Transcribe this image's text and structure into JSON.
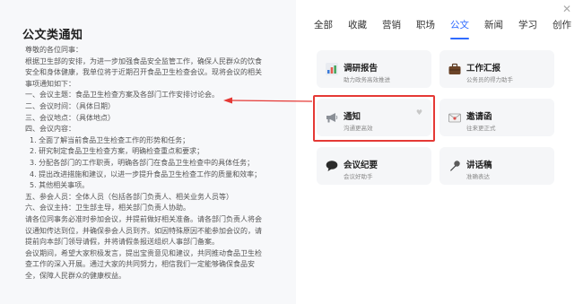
{
  "document": {
    "title": "公文类通知",
    "lines": [
      "尊敬的各位同事：",
      "根据卫生部的安排，为进一步加强食品安全监管工作，确保人民群众的饮食安全和身体健康，我单位将于近期召开食品卫生检查会议。现将会议的相关事项通知如下：",
      "一、会议主题：食品卫生检查方案及各部门工作安排讨论会。",
      "二、会议时间：（具体日期）",
      "三、会议地点：（具体地点）",
      "四、会议内容：",
      "1. 全面了解当前食品卫生检查工作的形势和任务；",
      "2. 研究制定食品卫生检查方案，明确检查重点和要求；",
      "3. 分配各部门的工作职责，明确各部门在食品卫生检查中的具体任务；",
      "4. 提出改进措施和建议，以进一步提升食品卫生检查工作的质量和效率；",
      "5. 其他相关事项。",
      "五、参会人员：全体人员（包括各部门负责人、相关业务人员等）",
      "六、会议主持：卫生部主导，相关部门负责人协助。",
      "请各位同事务必准时参加会议，并提前做好相关准备。请各部门负责人将会议通知传达到位，并确保参会人员到齐。如因特殊原因不能参加会议的，请提前向本部门领导请假，并将请假条报送组织人事部门备案。",
      "会议期间，希望大家积极发言，提出宝贵意见和建议，共同推动食品卫生检查工作的深入开展。通过大家的共同努力，相信我们一定能够确保食品安全，保障人民群众的健康权益。"
    ]
  },
  "tabs": [
    "全部",
    "收藏",
    "营销",
    "职场",
    "公文",
    "新闻",
    "学习",
    "创作"
  ],
  "active_tab": "公文",
  "close_label": "✕",
  "cards": [
    {
      "title": "调研报告",
      "subtitle": "助力政务高效推进",
      "icon": "bar-chart-icon"
    },
    {
      "title": "工作汇报",
      "subtitle": "公务员的得力助手",
      "icon": "briefcase-icon"
    },
    {
      "title": "通知",
      "subtitle": "沟通更高效",
      "icon": "megaphone-icon",
      "favorite_icon": "♥"
    },
    {
      "title": "邀请函",
      "subtitle": "往来更正式",
      "icon": "envelope-icon"
    },
    {
      "title": "会议纪要",
      "subtitle": "会议好助手",
      "icon": "speech-bubble-icon"
    },
    {
      "title": "讲话稿",
      "subtitle": "准确表达",
      "icon": "microphone-icon"
    }
  ],
  "colors": {
    "accent": "#2f6bff",
    "highlight": "#e53935"
  }
}
